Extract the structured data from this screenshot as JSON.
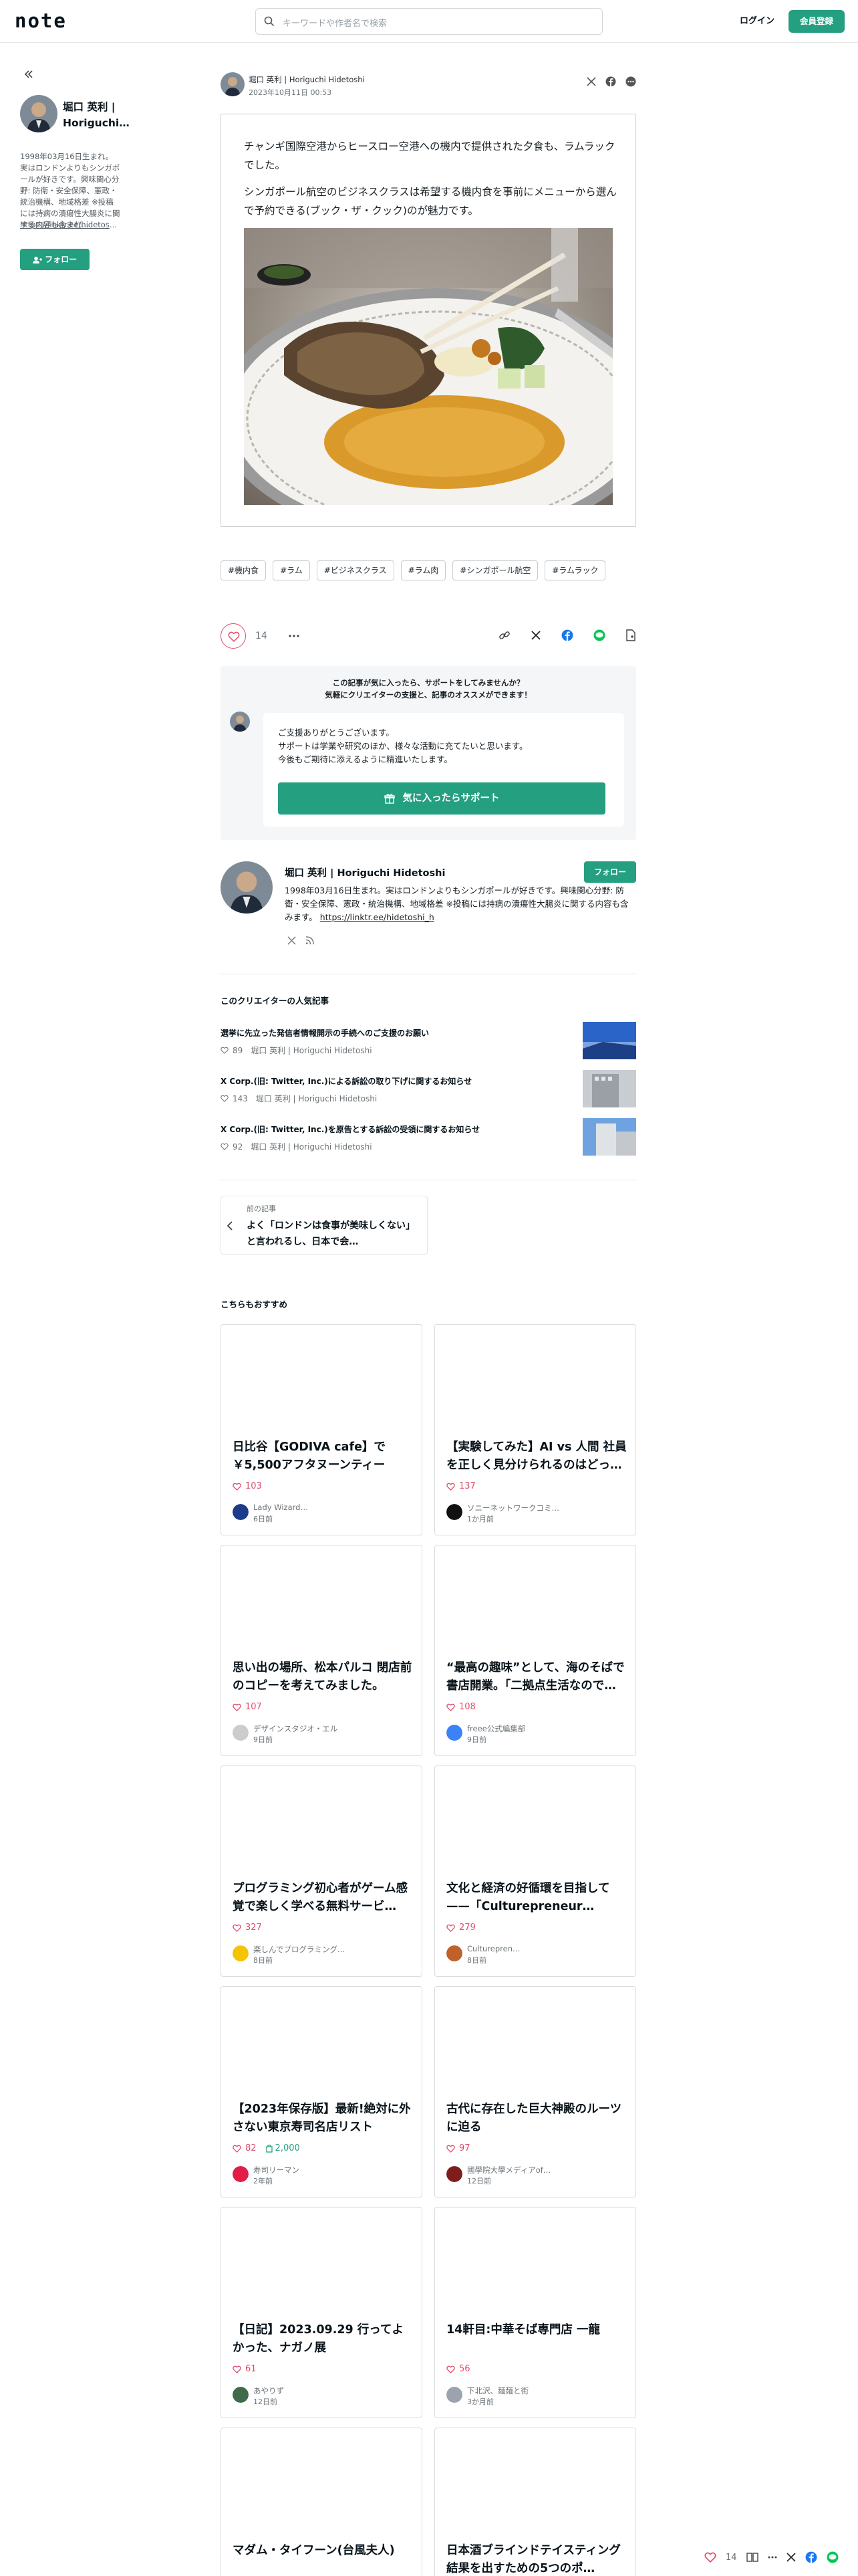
{
  "header": {
    "logo": "note",
    "search_placeholder": "キーワードや作者名で検索",
    "login": "ログイン",
    "signup": "会員登録"
  },
  "sidebar": {
    "name": "堀口 英利 | Horiguchi…",
    "bio": "1998年03月16日生まれ。実はロンドンよりもシンガポールが好きです。興味関心分野: 防衛・安全保障、憲政・統治機構、地域格差 ※投稿には持病の潰瘍性大腸炎に関する内容も含まれ…",
    "link": "https://linktr.ee/hidetoshi_h",
    "follow": "フォロー"
  },
  "article": {
    "author": "堀口 英利 | Horiguchi Hidetoshi",
    "date": "2023年10月11日 00:53",
    "paragraph1": "チャンギ国際空港からヒースロー空港への機内で提供された夕食も、ラムラックでした。",
    "paragraph2": "シンガポール航空のビジネスクラスは希望する機内食を事前にメニューから選んで予約できる(ブック・ザ・クック)のが魅力です。",
    "tags": [
      "#機内食",
      "#ラム",
      "#ビジネスクラス",
      "#ラム肉",
      "#シンガポール航空",
      "#ラムラック"
    ],
    "like_count": "14"
  },
  "support": {
    "title_line1": "この記事が気に入ったら、サポートをしてみませんか？",
    "title_line2": "気軽にクリエイターの支援と、記事のオススメができます！",
    "message": "ご支援ありがとうございます。\nサポートは学業や研究のほか、様々な活動に充てたいと思います。\n今後もご期待に添えるように精進いたします。",
    "button": "気に入ったらサポート"
  },
  "profile": {
    "name": "堀口 英利 | Horiguchi Hidetoshi",
    "follow": "フォロー",
    "bio": "1998年03月16日生まれ。実はロンドンよりもシンガポールが好きです。興味関心分野: 防衛・安全保障、憲政・統治機構、地域格差 ※投稿には持病の潰瘍性大腸炎に関する内容も含みます。",
    "link": "https://linktr.ee/hidetoshi_h"
  },
  "popular": {
    "title": "このクリエイターの人気記事",
    "items": [
      {
        "title": "選挙に先立った発信者情報開示の手続へのご支援のお願い",
        "likes": "89",
        "author": "堀口 英利 | Horiguchi Hidetoshi"
      },
      {
        "title": "X Corp.(旧: Twitter, Inc.)による訴訟の取り下げに関するお知らせ",
        "likes": "143",
        "author": "堀口 英利 | Horiguchi Hidetoshi"
      },
      {
        "title": "X Corp.(旧: Twitter, Inc.)を原告とする訴訟の受領に関するお知らせ",
        "likes": "92",
        "author": "堀口 英利 | Horiguchi Hidetoshi"
      }
    ]
  },
  "previous": {
    "label": "前の記事",
    "title": "よく「ロンドンは食事が美味しくない」と言われるし、日本で会…"
  },
  "recommend": {
    "title": "こちらもおすすめ",
    "cards": [
      {
        "title": "日比谷【GODIVA cafe】で￥5,500アフタヌーンティー",
        "likes": "103",
        "tip": "",
        "author": "Lady Wizard…",
        "date": "6日前"
      },
      {
        "title": "【実験してみた】AI vs 人間 社員を正しく見分けられるのはどっ…",
        "likes": "137",
        "tip": "",
        "author": "ソニーネットワークコミ…",
        "date": "1か月前"
      },
      {
        "title": "思い出の場所、松本パルコ 閉店前のコピーを考えてみました。",
        "likes": "107",
        "tip": "",
        "author": "デザインスタジオ・エル",
        "date": "9日前"
      },
      {
        "title": "“最高の趣味”として、海のそばで書店開業。「二拠点生活なので…",
        "likes": "108",
        "tip": "",
        "author": "freee公式編集部",
        "date": "9日前"
      },
      {
        "title": "プログラミング初心者がゲーム感覚で楽しく学べる無料サービ…",
        "likes": "327",
        "tip": "",
        "author": "楽しんでプログラミング…",
        "date": "8日前"
      },
      {
        "title": "文化と経済の好循環を目指して——「Culturepreneur…",
        "likes": "279",
        "tip": "",
        "author": "Culturepren…",
        "date": "8日前"
      },
      {
        "title": "【2023年保存版】最新!絶対に外さない東京寿司名店リスト",
        "likes": "82",
        "tip": "2,000",
        "author": "寿司リーマン",
        "date": "2年前"
      },
      {
        "title": "古代に存在した巨大神殿のルーツに迫る",
        "likes": "97",
        "tip": "",
        "author": "國學院大學メディアof…",
        "date": "12日前"
      },
      {
        "title": "【日記】2023.09.29 行ってよかった、ナガノ展",
        "likes": "61",
        "tip": "",
        "author": "あやりず",
        "date": "12日前"
      },
      {
        "title": "14軒目:中華そば専門店 一龍",
        "likes": "56",
        "tip": "",
        "author": "下北沢、麺麺と街",
        "date": "3か月前"
      },
      {
        "title": "マダム・タイフーン(台風夫人)",
        "likes": "",
        "tip": "",
        "author": "",
        "date": ""
      },
      {
        "title": "日本酒ブラインドテイスティング結果を出すための5つのポ…",
        "likes": "",
        "tip": "",
        "author": "",
        "date": ""
      }
    ]
  },
  "floatbar": {
    "like_count": "14"
  },
  "colors": {
    "accent": "#249f80",
    "like": "#e04b6b",
    "text": "#08131a"
  }
}
